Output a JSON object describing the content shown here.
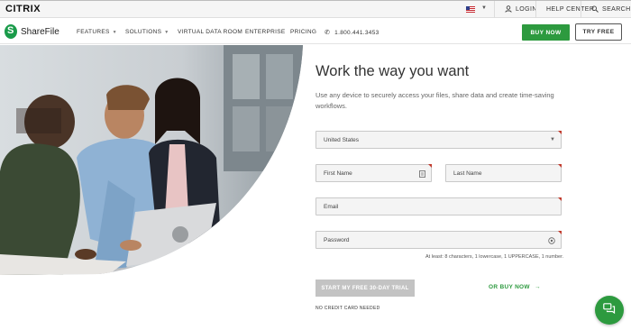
{
  "topbar": {
    "brand": "CITRIX",
    "flag_icon": "us-flag-icon",
    "login_label": "LOGIN",
    "help_label": "HELP CENTER",
    "search_label": "SEARCH"
  },
  "nav": {
    "logo_text": "ShareFile",
    "items": [
      {
        "label": "FEATURES",
        "has_dropdown": true
      },
      {
        "label": "SOLUTIONS",
        "has_dropdown": true
      },
      {
        "label": "VIRTUAL DATA ROOM",
        "has_dropdown": false
      },
      {
        "label": "ENTERPRISE",
        "has_dropdown": false
      },
      {
        "label": "PRICING",
        "has_dropdown": false
      }
    ],
    "phone": "1.800.441.3453",
    "buy_label": "BUY NOW",
    "try_label": "TRY FREE"
  },
  "form": {
    "title": "Work the way you want",
    "subtitle": "Use any device to securely access your files, share data and create time-saving workflows.",
    "country_value": "United States",
    "first_name_placeholder": "First Name",
    "last_name_placeholder": "Last Name",
    "email_placeholder": "Email",
    "password_placeholder": "Password",
    "password_hint": "At least: 8 characters, 1 lowercase, 1 UPPERCASE, 1 number.",
    "trial_button": "START MY FREE 30-DAY TRIAL",
    "or_buy": "OR BUY NOW",
    "no_credit": "NO CREDIT CARD NEEDED"
  },
  "colors": {
    "brand_green": "#2d9a3f",
    "required_marker": "#c0392b",
    "disabled_button": "#c3c3c3"
  }
}
